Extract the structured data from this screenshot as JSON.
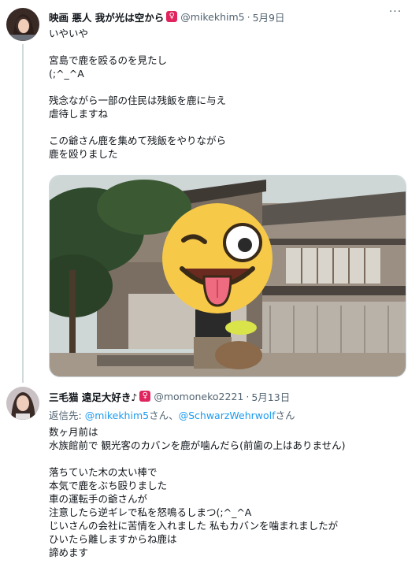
{
  "tweets": [
    {
      "name": "映画 悪人 我が光は空から",
      "symbol": "♀",
      "handle": "@mikekhim5",
      "separator": "·",
      "date": "5月9日",
      "more": "···",
      "lines": [
        "いやいや",
        "",
        "宮島で鹿を殴るのを見たし",
        "(;^_^A",
        "",
        "残念ながら一部の住民は残飯を鹿に与え",
        "虐待しますね",
        "",
        "この爺さん鹿を集めて残飯をやりながら",
        "鹿を殴りました"
      ]
    },
    {
      "name": "三毛猫 遠足大好き♪",
      "symbol": "♀",
      "handle": "@momoneko2221",
      "separator": "·",
      "date": "5月13日",
      "reply_prefix": "返信先: ",
      "reply_user1": "@mikekhim5",
      "reply_mid": "さん、",
      "reply_user2": "@SchwarzWehrwolf",
      "reply_suffix": "さん",
      "lines": [
        "数ヶ月前は",
        "水族館前で 観光客のカバンを鹿が噛んだら(前歯の上はありません)",
        "",
        "落ちていた木の太い棒で",
        "本気で鹿をぶち殴りました",
        "車の運転手の爺さんが",
        "注意したら逆ギレで私を怒鳴るしまつ(;^_^A",
        "じいさんの会社に苦情を入れました 私もカバンを噛まれましたが",
        "ひいたら離しますからね鹿は",
        "諦めます"
      ]
    }
  ]
}
